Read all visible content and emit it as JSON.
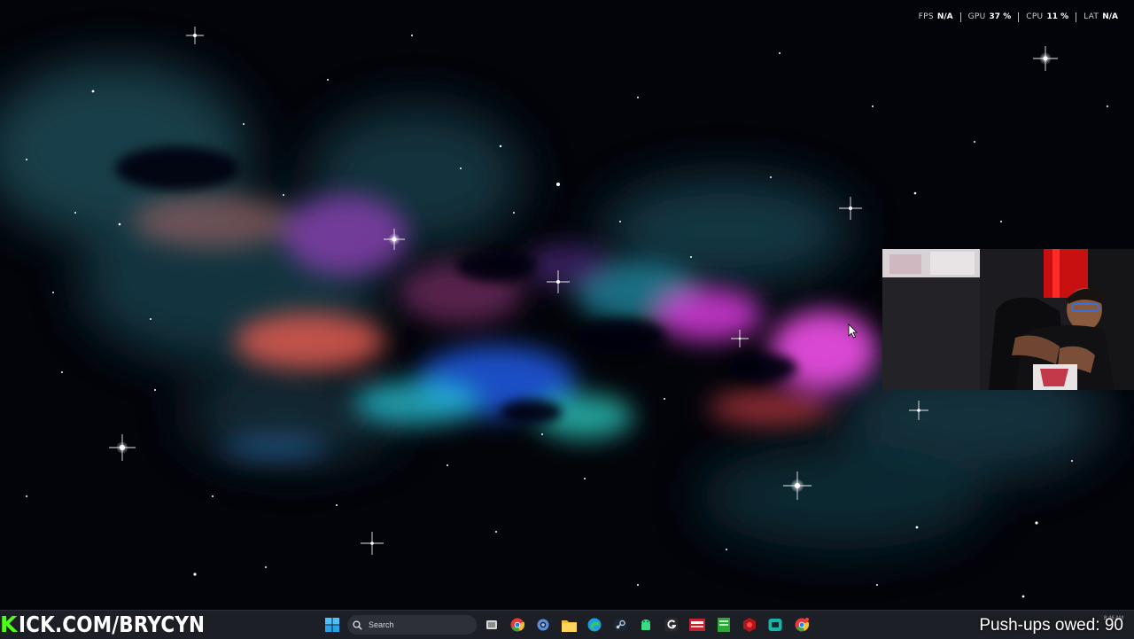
{
  "perf_overlay": {
    "items": [
      {
        "label": "FPS",
        "value": "N/A"
      },
      {
        "label": "GPU",
        "value": "37 %"
      },
      {
        "label": "CPU",
        "value": "11 %"
      },
      {
        "label": "LAT",
        "value": "N/A"
      }
    ]
  },
  "webcam": {
    "description_icon": "webcam-feed"
  },
  "taskbar": {
    "kick_letter": "K",
    "kick_rest": "ICK.COM/BRYCYN",
    "search_placeholder": "Search",
    "icons": [
      "windows-start-icon",
      "search-icon",
      "task-view-icon",
      "chrome-icon",
      "settings-icon",
      "file-explorer-icon",
      "edge-icon",
      "steam-icon",
      "android-icon",
      "g-hub-icon",
      "voicemeeter-icon",
      "green-app-icon",
      "red-app-icon",
      "teal-app-icon",
      "chrome-alt-icon"
    ],
    "pushups_text": "Push-ups owed: 90",
    "clock_time": "8:46 AM"
  },
  "colors": {
    "kick_green": "#53fc18",
    "taskbar_bg": "#1d1f26"
  }
}
